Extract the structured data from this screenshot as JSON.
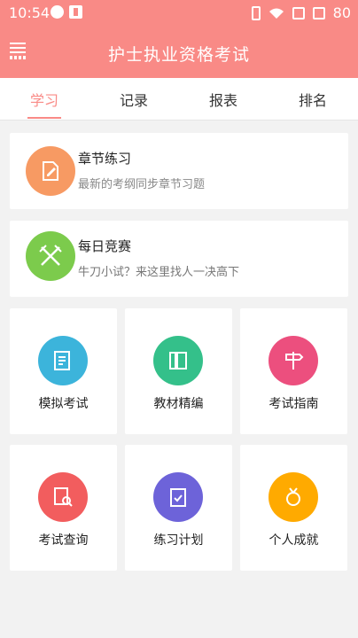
{
  "status_bar": {
    "time": "10:54",
    "battery": "80"
  },
  "header": {
    "title": "护士执业资格考试"
  },
  "tabs": [
    {
      "label": "学习",
      "active": true
    },
    {
      "label": "记录",
      "active": false
    },
    {
      "label": "报表",
      "active": false
    },
    {
      "label": "排名",
      "active": false
    }
  ],
  "list_cards": [
    {
      "title": "章节练习",
      "subtitle": "最新的考纲同步章节习题",
      "icon": "document-pen-icon",
      "color": "#f79a63"
    },
    {
      "title": "每日竞赛",
      "subtitle": "牛刀小试？来这里找人一决高下",
      "icon": "crossed-swords-icon",
      "color": "#7ccb4c"
    }
  ],
  "grid_tiles": [
    {
      "label": "模拟考试",
      "icon": "exam-paper-icon",
      "color": "#3cb4db"
    },
    {
      "label": "教材精编",
      "icon": "books-icon",
      "color": "#34c08a"
    },
    {
      "label": "考试指南",
      "icon": "signpost-icon",
      "color": "#ec4f7e"
    },
    {
      "label": "考试查询",
      "icon": "search-document-icon",
      "color": "#f25d5e"
    },
    {
      "label": "练习计划",
      "icon": "clipboard-check-icon",
      "color": "#6d63d9"
    },
    {
      "label": "个人成就",
      "icon": "medal-icon",
      "color": "#ffaa00"
    }
  ]
}
